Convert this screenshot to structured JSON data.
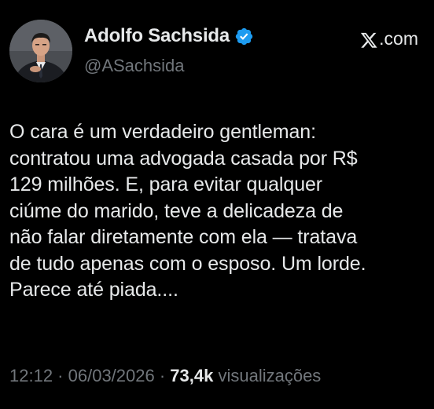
{
  "author": {
    "display_name": "Adolfo Sachsida",
    "handle": "@ASachsida",
    "verified": true,
    "verified_icon": "verified-badge-icon",
    "avatar_icon": "profile-photo"
  },
  "source": {
    "label": ".com",
    "logo_icon": "x-logo-icon"
  },
  "tweet": {
    "text": "O cara é um verdadeiro gentleman:\ncontratou uma advogada casada por R$\n129 milhões. E, para evitar qualquer\nciúme do marido, teve a delicadeza de\nnão falar diretamente com ela — tratava\nde tudo apenas com o esposo. Um lorde.\nParece até piada...."
  },
  "meta": {
    "time": "12:12",
    "sep1": " · ",
    "date": "06/03/2026",
    "sep2": " · ",
    "views_count": "73,4k",
    "views_label": " visualizações"
  },
  "colors": {
    "background": "#000000",
    "text": "#e7e9ea",
    "secondary": "#71767b",
    "verified": "#1d9bf0"
  }
}
